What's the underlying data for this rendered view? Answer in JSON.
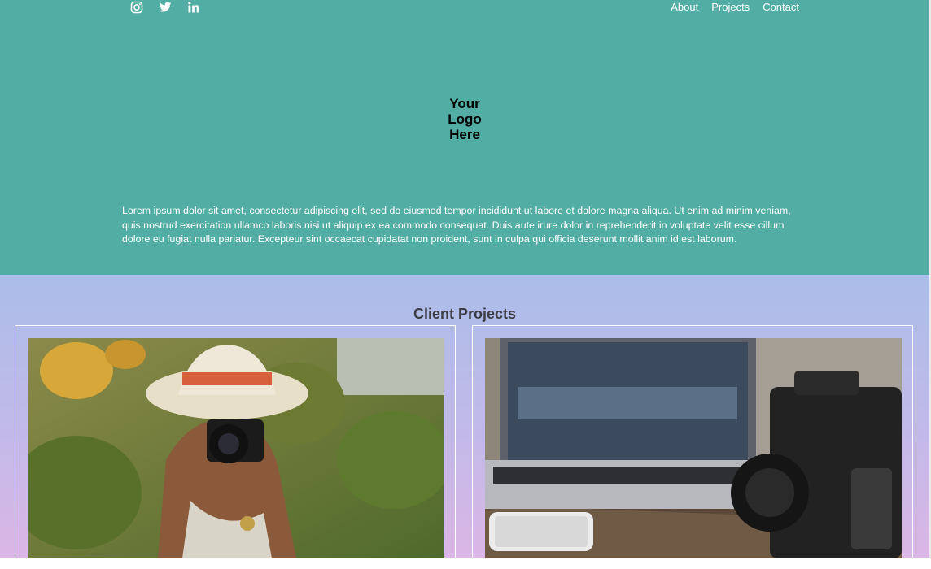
{
  "header": {
    "social_icons": [
      "instagram-icon",
      "twitter-icon",
      "linkedin-icon"
    ],
    "nav": [
      "About",
      "Projects",
      "Contact"
    ]
  },
  "hero": {
    "logo_lines": [
      "Your",
      "Logo",
      "Here"
    ],
    "intro": "Lorem ipsum dolor sit amet, consectetur adipiscing elit, sed do eiusmod tempor incididunt ut labore et dolore magna aliqua. Ut enim ad minim veniam, quis nostrud exercitation ullamco laboris nisi ut aliquip ex ea commodo consequat. Duis aute irure dolor in reprehenderit in voluptate velit esse cillum dolore eu fugiat nulla pariatur. Excepteur sint occaecat cupidatat non proident, sunt in culpa qui officia deserunt mollit anim id est laborum."
  },
  "projects": {
    "title": "Client Projects"
  },
  "colors": {
    "hero_bg": "#52ada4",
    "projects_gradient_top": "#abbde9",
    "projects_gradient_bottom": "#dbb6e6"
  }
}
